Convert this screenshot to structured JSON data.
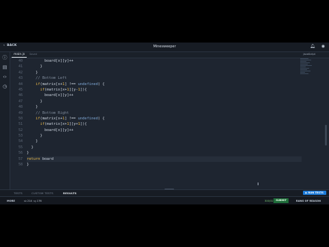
{
  "titlebar": {
    "back_label": "BACK",
    "title": "Minesweeper"
  },
  "tabs": {
    "file": "main.js",
    "saved": "Saved",
    "language": "JavaScript"
  },
  "editor": {
    "lines": [
      {
        "n": "40",
        "tokens": [
          {
            "t": "        ",
            "c": "op"
          },
          {
            "t": "board[x][y]++",
            "c": "id"
          }
        ]
      },
      {
        "n": "41",
        "tokens": [
          {
            "t": "      }",
            "c": "op"
          }
        ]
      },
      {
        "n": "42",
        "tokens": [
          {
            "t": "    }",
            "c": "op"
          }
        ]
      },
      {
        "n": "43",
        "tokens": [
          {
            "t": "    // Bottom Left",
            "c": "cm"
          }
        ]
      },
      {
        "n": "44",
        "tokens": [
          {
            "t": "    ",
            "c": "op"
          },
          {
            "t": "if",
            "c": "kw"
          },
          {
            "t": "(matrix[x+",
            "c": "id"
          },
          {
            "t": "1",
            "c": "num"
          },
          {
            "t": "] !== ",
            "c": "op"
          },
          {
            "t": "undefined",
            "c": "und"
          },
          {
            "t": ") {",
            "c": "op"
          }
        ]
      },
      {
        "n": "45",
        "tokens": [
          {
            "t": "      ",
            "c": "op"
          },
          {
            "t": "if",
            "c": "kw"
          },
          {
            "t": "(matrix[x+",
            "c": "id"
          },
          {
            "t": "1",
            "c": "num"
          },
          {
            "t": "][y-",
            "c": "id"
          },
          {
            "t": "1",
            "c": "num"
          },
          {
            "t": "]){",
            "c": "op"
          }
        ]
      },
      {
        "n": "46",
        "tokens": [
          {
            "t": "        ",
            "c": "op"
          },
          {
            "t": "board[x][y]++",
            "c": "id"
          }
        ]
      },
      {
        "n": "47",
        "tokens": [
          {
            "t": "      }",
            "c": "op"
          }
        ]
      },
      {
        "n": "48",
        "tokens": [
          {
            "t": "    }",
            "c": "op"
          }
        ]
      },
      {
        "n": "49",
        "tokens": [
          {
            "t": "    // Bottom Right",
            "c": "cm"
          }
        ]
      },
      {
        "n": "50",
        "tokens": [
          {
            "t": "    ",
            "c": "op"
          },
          {
            "t": "if",
            "c": "kw"
          },
          {
            "t": "(matrix[x+",
            "c": "id"
          },
          {
            "t": "1",
            "c": "num"
          },
          {
            "t": "] !== ",
            "c": "op"
          },
          {
            "t": "undefined",
            "c": "und"
          },
          {
            "t": ") {",
            "c": "op"
          }
        ]
      },
      {
        "n": "51",
        "tokens": [
          {
            "t": "      ",
            "c": "op"
          },
          {
            "t": "if",
            "c": "kw"
          },
          {
            "t": "(matrix[x+",
            "c": "id"
          },
          {
            "t": "1",
            "c": "num"
          },
          {
            "t": "][y+",
            "c": "id"
          },
          {
            "t": "1",
            "c": "num"
          },
          {
            "t": "]){",
            "c": "op"
          }
        ]
      },
      {
        "n": "52",
        "tokens": [
          {
            "t": "        ",
            "c": "op"
          },
          {
            "t": "board[x][y]++",
            "c": "id"
          }
        ]
      },
      {
        "n": "53",
        "tokens": [
          {
            "t": "      }",
            "c": "op"
          }
        ]
      },
      {
        "n": "54",
        "tokens": [
          {
            "t": "    }",
            "c": "op"
          }
        ]
      },
      {
        "n": "55",
        "tokens": [
          {
            "t": "  }",
            "c": "op"
          }
        ]
      },
      {
        "n": "56",
        "tokens": [
          {
            "t": "}",
            "c": "op"
          }
        ]
      },
      {
        "n": "57",
        "tokens": [
          {
            "t": "return ",
            "c": "kw"
          },
          {
            "t": "board",
            "c": "id"
          }
        ],
        "hl": true
      },
      {
        "n": "58",
        "tokens": [
          {
            "t": "}",
            "c": "op"
          }
        ]
      }
    ]
  },
  "bottom_tabs": {
    "tests": "TESTS",
    "custom_tests": "CUSTOM TESTS",
    "results": "RESULTS",
    "run": "RUN TESTS"
  },
  "status": {
    "more": "MORE",
    "likes": "214",
    "dislikes": "176",
    "score": "300/320",
    "submit": "SUBMIT",
    "reason": "RANG OF REASON"
  },
  "colors": {
    "accent": "#1d7bd9",
    "submit": "#1f6d3a",
    "editor_bg": "#1e2530"
  }
}
